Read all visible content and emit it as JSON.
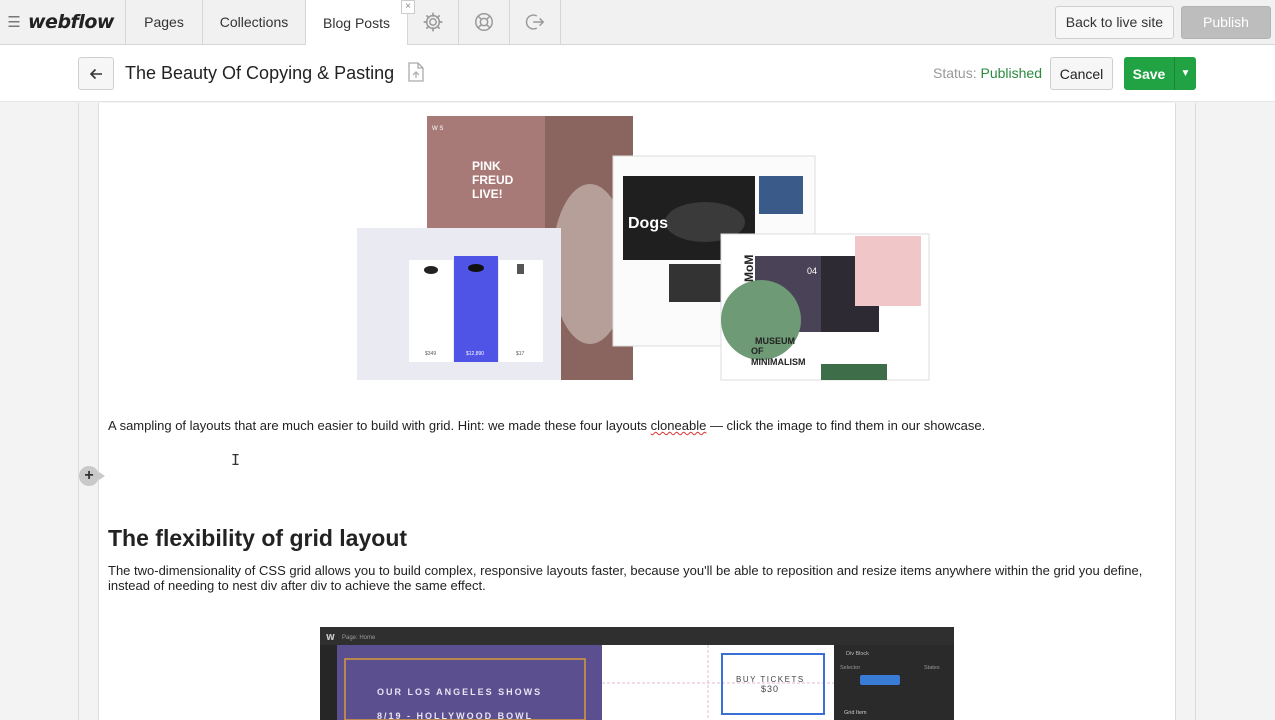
{
  "topnav": {
    "logo": "webflow",
    "tabs": [
      {
        "label": "Pages"
      },
      {
        "label": "Collections"
      },
      {
        "label": "Blog Posts"
      }
    ],
    "tab_close": "×",
    "back_to_live": "Back to live site",
    "publish": "Publish"
  },
  "editor": {
    "title": "The Beauty Of Copying & Pasting",
    "status_label": "Status:",
    "status_value": "Published",
    "cancel": "Cancel",
    "save": "Save"
  },
  "hero_image": {
    "pink_title": [
      "PINK",
      "FREUD",
      "LIVE!"
    ],
    "dogs_title": "Dogs",
    "mom_title": "MoM",
    "museum_title": [
      "MUSEUM",
      "OF",
      "MINIMALISM"
    ],
    "number": "04",
    "prices": [
      "$349",
      "$12,890",
      "$17"
    ]
  },
  "content": {
    "caption_before": "A sampling of layouts that are much easier to build with grid. Hint: we made these four layouts ",
    "caption_misspelled": "cloneable",
    "caption_after": " — click the image to find them in our showcase.",
    "heading": "The flexibility of grid layout",
    "paragraph": "The two-dimensionality of CSS grid allows you to build complex, responsive layouts faster,  because you'll be able to reposition and resize items anywhere within the grid you define, instead of needing to nest div after div to achieve the same effect."
  },
  "designer_shot": {
    "shows_title": "OUR LOS ANGELES SHOWS",
    "shows_line": "8/19 - HOLLYWOOD BOWL",
    "tickets": "BUY TICKETS",
    "price": "$30",
    "page_label": "Page: Home",
    "panel_item1": "Div Block",
    "panel_item2": "Selector",
    "panel_item3": "Grid Item",
    "states": "States"
  },
  "colors": {
    "accent_green": "#21a243",
    "status_green": "#2b8a3e"
  }
}
